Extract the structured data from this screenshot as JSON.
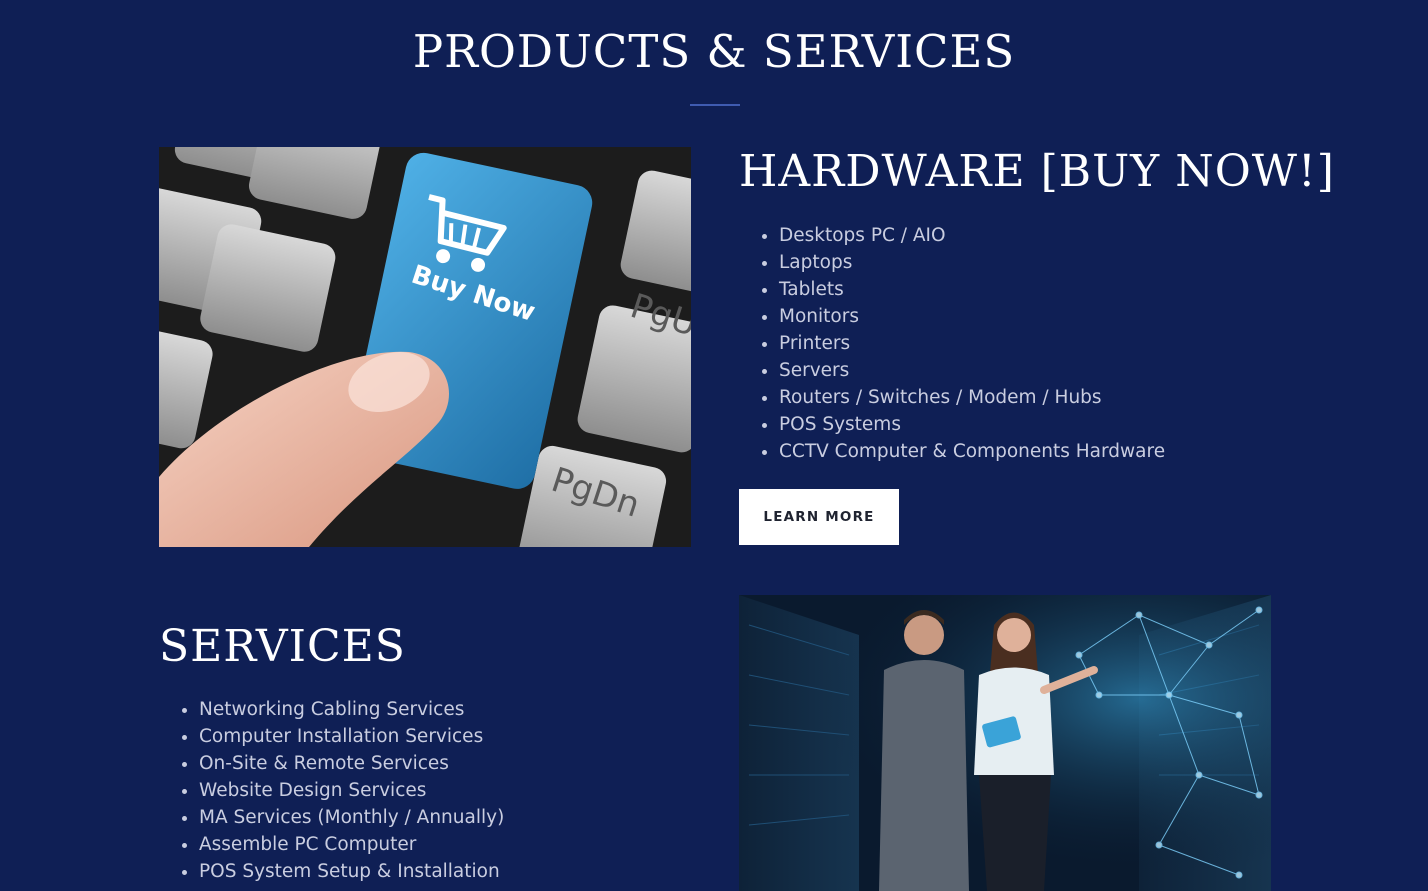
{
  "page": {
    "title": "PRODUCTS & SERVICES"
  },
  "hardware": {
    "heading": "HARDWARE [BUY NOW!]",
    "items": [
      "Desktops PC / AIO",
      "Laptops",
      "Tablets",
      "Monitors",
      "Printers",
      "Servers",
      "Routers / Switches / Modem / Hubs",
      "POS Systems",
      "CCTV Computer & Components Hardware"
    ],
    "button_label": "LEARN MORE",
    "image": {
      "key_label": "Buy Now",
      "key_pgup": "PgU",
      "key_pgdn": "PgDn"
    }
  },
  "services": {
    "heading": "SERVICES",
    "items": [
      "Networking Cabling Services",
      "Computer Installation Services",
      "On-Site & Remote Services",
      "Website Design Services",
      "MA Services (Monthly / Annually)",
      "Assemble PC Computer",
      "POS System Setup & Installation"
    ]
  },
  "colors": {
    "background": "#0f1f55",
    "divider": "#3f5bb0",
    "list_text": "#c9cde0",
    "button_bg": "#ffffff",
    "button_text": "#1f2330",
    "key_blue": "#2f8fca"
  }
}
